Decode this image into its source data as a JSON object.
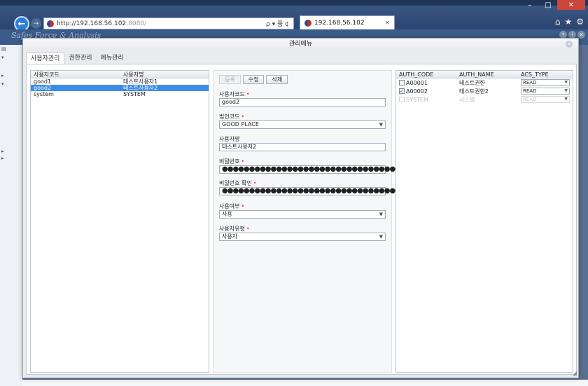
{
  "browser": {
    "url_host": "http://192.168.56.102",
    "url_rest": ":8080/",
    "addr_tools": "ρ ▾ 품 ¢",
    "tab_title": "192.168.56.102",
    "tab_close": "×"
  },
  "app": {
    "logo": "Safes Force & Analysis"
  },
  "modal": {
    "title": "관리메뉴",
    "tabs": [
      "사용자관리",
      "권한관리",
      "메뉴관리"
    ]
  },
  "users_grid": {
    "headers": [
      "사용자코드",
      "사용자명"
    ],
    "rows": [
      {
        "code": "good1",
        "name": "테스트사용자1",
        "selected": false
      },
      {
        "code": "good2",
        "name": "테스트사용자2",
        "selected": true
      },
      {
        "code": "system",
        "name": "SYSTEM",
        "selected": false
      }
    ]
  },
  "form": {
    "buttons": [
      "등록",
      "수정",
      "삭제"
    ],
    "user_code_label": "사용자코드",
    "user_code_value": "good2",
    "corp_code_label": "법인코드",
    "corp_code_value": "GOOD PLACE",
    "user_name_label": "사용자명",
    "user_name_value": "테스트사용자2",
    "password_label": "비밀번호",
    "password_dots": "●●●●●●●●●●●●●●●●●●●●●●●●●●●●●●●●●●●",
    "password_confirm_label": "비밀번호 확인",
    "use_yn_label": "사용여부",
    "use_yn_value": "사용",
    "user_type_label": "사용자유형",
    "user_type_value": "사용자",
    "required_mark": "•"
  },
  "auth_grid": {
    "headers": [
      "AUTH_CODE",
      "AUTH_NAME",
      "ACS_TYPE"
    ],
    "rows": [
      {
        "code": "A00001",
        "name": "테스트권한",
        "type": "READ",
        "checked": false,
        "disabled": false
      },
      {
        "code": "A00002",
        "name": "테스트권한2",
        "type": "READ",
        "checked": true,
        "disabled": false
      },
      {
        "code": "SYSTEM",
        "name": "시스템",
        "type": "READ",
        "checked": false,
        "disabled": true
      }
    ]
  },
  "colors": {
    "selected_row": "#3c8ce6",
    "required": "#e03a3a"
  }
}
